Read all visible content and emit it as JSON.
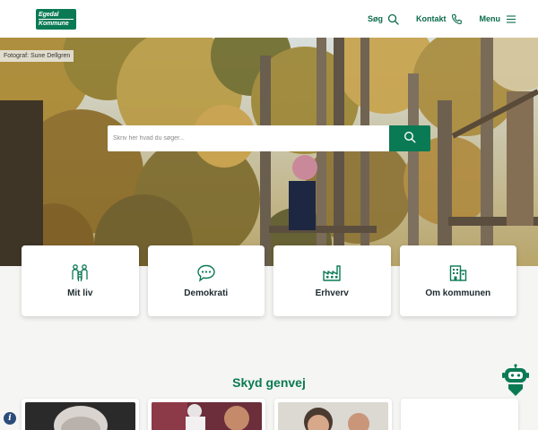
{
  "header": {
    "logo_line1": "Egedal",
    "logo_line2": "Kommune",
    "nav": [
      {
        "label": "Søg",
        "icon": "search-icon"
      },
      {
        "label": "Kontakt",
        "icon": "phone-icon"
      },
      {
        "label": "Menu",
        "icon": "hamburger-icon"
      }
    ]
  },
  "hero": {
    "photo_credit": "Fotograf: Sune Dellgren",
    "search_placeholder": "Skriv her hvad du søger..."
  },
  "cards": [
    {
      "label": "Mit liv",
      "icon": "family-icon"
    },
    {
      "label": "Demokrati",
      "icon": "speech-bubble-icon"
    },
    {
      "label": "Erhverv",
      "icon": "factory-icon"
    },
    {
      "label": "Om kommunen",
      "icon": "building-icon"
    }
  ],
  "shortcuts": {
    "title": "Skyd genvej"
  },
  "colors": {
    "brand": "#0a7a54",
    "text": "#1d2a2e",
    "background": "#f5f5f4"
  }
}
